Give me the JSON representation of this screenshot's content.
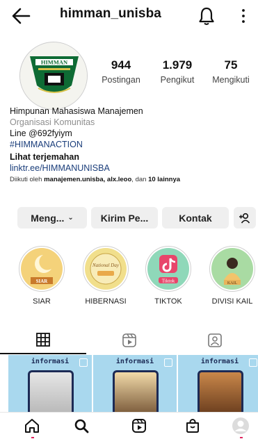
{
  "header": {
    "username": "himman_unisba",
    "back_icon": "arrow-left-icon",
    "bell_icon": "bell-icon",
    "menu_icon": "kebab-menu-icon"
  },
  "profile": {
    "avatar_text": "HIMMAN",
    "stats": {
      "posts": {
        "value": "944",
        "label": "Postingan"
      },
      "followers": {
        "value": "1.979",
        "label": "Pengikut"
      },
      "following": {
        "value": "75",
        "label": "Mengikuti"
      }
    },
    "bio": {
      "name": "Himpunan Mahasiswa Manajemen",
      "category": "Organisasi Komunitas",
      "line1": "Line @692fyiym",
      "hashtag": "#HIMMANACTION",
      "translate": "Lihat terjemahan",
      "link": "linktr.ee/HIMMANUNISBA",
      "followed_prefix": "Diikuti oleh",
      "followed_users": "manajemen.unisba, alx.leoo",
      "followed_mid": ", dan",
      "followed_count": "10 lainnya"
    }
  },
  "actions": {
    "follow_label": "Meng...",
    "follow_chevron": "⌄",
    "message_label": "Kirim Pe...",
    "contact_label": "Kontak",
    "add_person_icon": "add-person-icon"
  },
  "highlights": [
    {
      "label": "SIAR",
      "badge": "SIAR",
      "color": "#f4d27a"
    },
    {
      "label": "HIBERNASI",
      "badge": "National Day",
      "color": "#f1df8c"
    },
    {
      "label": "TIKTOK",
      "badge": "Tiktok",
      "color": "#8fd8b9"
    },
    {
      "label": "DIVISI KAIL",
      "badge": "KAIL",
      "color": "#a9dba3"
    }
  ],
  "tabs": [
    "grid-icon",
    "reels-icon",
    "tagged-icon"
  ],
  "posts": [
    {
      "title": "informasi"
    },
    {
      "title": "informasi"
    },
    {
      "title": "informasi"
    }
  ],
  "nav": [
    "home-icon",
    "search-icon",
    "reels-icon",
    "shop-icon",
    "profile-avatar"
  ]
}
